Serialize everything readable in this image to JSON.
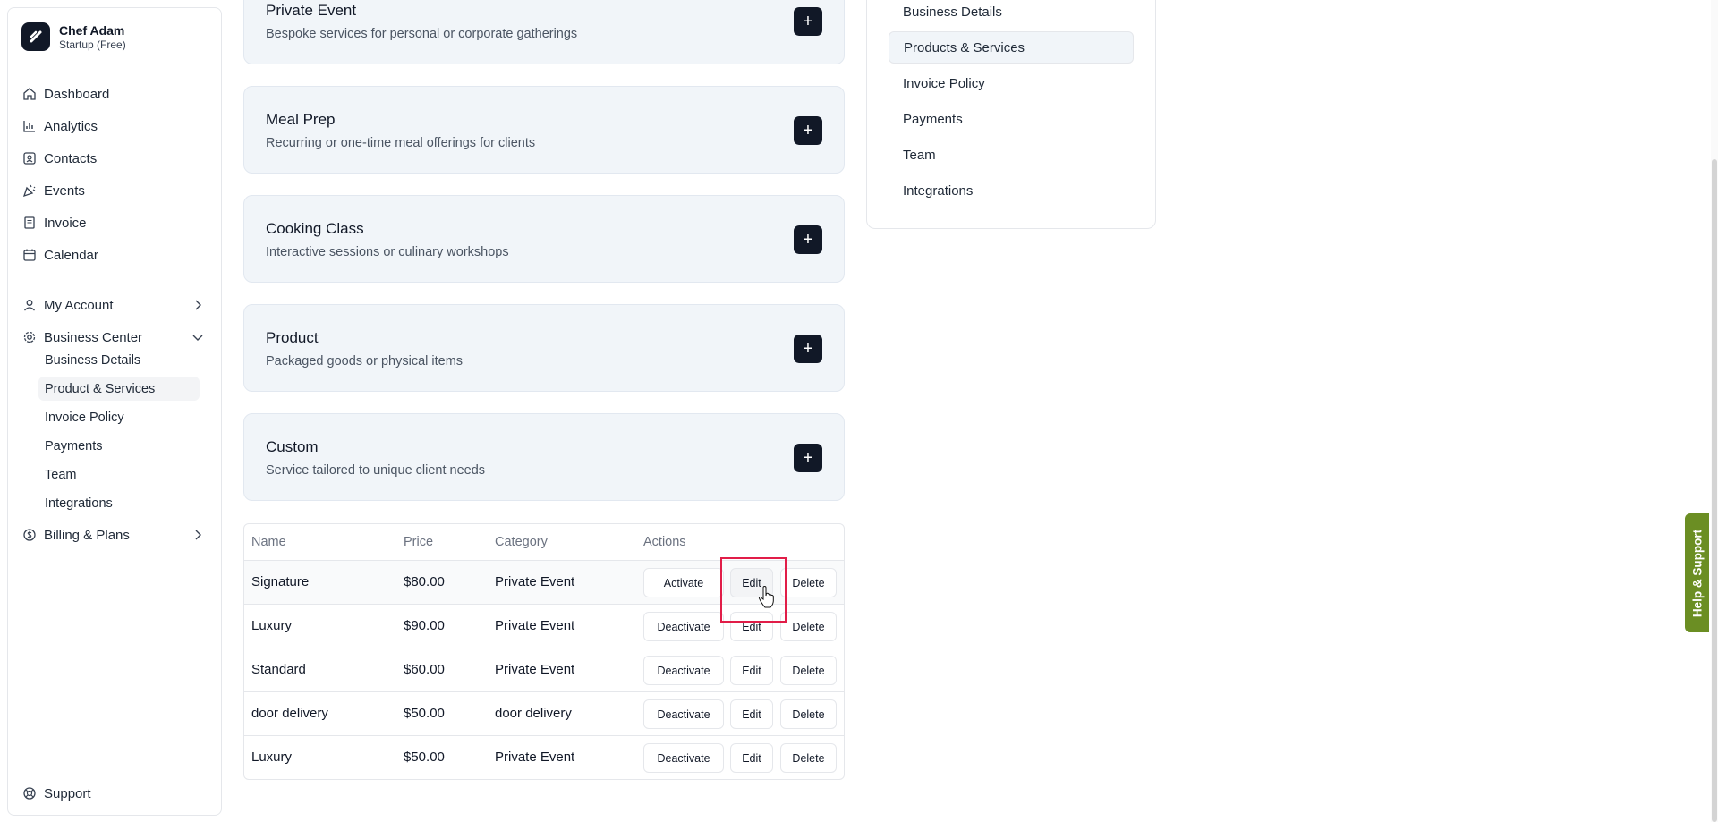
{
  "brand": {
    "name": "Chef Adam",
    "plan": "Startup (Free)"
  },
  "sidebar": {
    "items": [
      {
        "label": "Dashboard",
        "icon": "home-icon"
      },
      {
        "label": "Analytics",
        "icon": "bar-chart-icon"
      },
      {
        "label": "Contacts",
        "icon": "contact-card-icon"
      },
      {
        "label": "Events",
        "icon": "party-popper-icon"
      },
      {
        "label": "Invoice",
        "icon": "receipt-icon"
      },
      {
        "label": "Calendar",
        "icon": "calendar-icon"
      },
      {
        "label": "My Account",
        "icon": "user-icon"
      },
      {
        "label": "Business Center",
        "icon": "gear-icon"
      },
      {
        "label": "Billing & Plans",
        "icon": "dollar-circle-icon"
      }
    ],
    "business_center_subitems": [
      "Business Details",
      "Product & Services",
      "Invoice Policy",
      "Payments",
      "Team",
      "Integrations"
    ],
    "support_label": "Support"
  },
  "categories": [
    {
      "title": "Private Event",
      "description": "Bespoke services for personal or corporate gatherings"
    },
    {
      "title": "Meal Prep",
      "description": "Recurring or one-time meal offerings for clients"
    },
    {
      "title": "Cooking Class",
      "description": "Interactive sessions or culinary workshops"
    },
    {
      "title": "Product",
      "description": "Packaged goods or physical items"
    },
    {
      "title": "Custom",
      "description": "Service tailored to unique client needs"
    }
  ],
  "plus_symbol": "+",
  "table": {
    "headers": {
      "name": "Name",
      "price": "Price",
      "category": "Category",
      "actions": "Actions"
    },
    "rows": [
      {
        "name": "Signature",
        "price": "$80.00",
        "category": "Private Event",
        "toggle": "Activate",
        "edit": "Edit",
        "delete": "Delete"
      },
      {
        "name": "Luxury",
        "price": "$90.00",
        "category": "Private Event",
        "toggle": "Deactivate",
        "edit": "Edit",
        "delete": "Delete"
      },
      {
        "name": "Standard",
        "price": "$60.00",
        "category": "Private Event",
        "toggle": "Deactivate",
        "edit": "Edit",
        "delete": "Delete"
      },
      {
        "name": "door delivery",
        "price": "$50.00",
        "category": "door delivery",
        "toggle": "Deactivate",
        "edit": "Edit",
        "delete": "Delete"
      },
      {
        "name": "Luxury",
        "price": "$50.00",
        "category": "Private Event",
        "toggle": "Deactivate",
        "edit": "Edit",
        "delete": "Delete"
      }
    ]
  },
  "settings_panel": {
    "items": [
      "Business Details",
      "Products & Services",
      "Invoice Policy",
      "Payments",
      "Team",
      "Integrations"
    ],
    "active": "Products & Services"
  },
  "help_tab": "Help & Support",
  "colors": {
    "primary_dark": "#111827",
    "card_bg": "#f1f5f9",
    "highlight": "#e11d48",
    "help_green": "#6b8e23"
  }
}
